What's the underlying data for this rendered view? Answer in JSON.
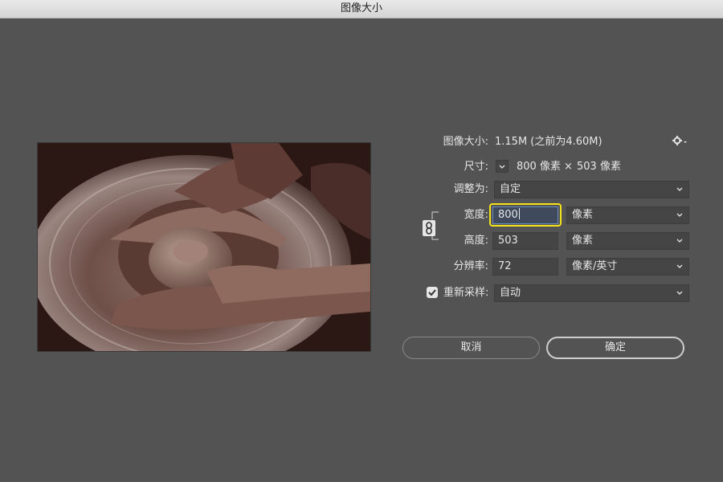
{
  "window": {
    "title": "图像大小"
  },
  "info": {
    "image_size_label": "图像大小:",
    "image_size_value": "1.15M (之前为4.60M)",
    "dimensions_label": "尺寸:",
    "dimensions_width": "800 像素",
    "dimensions_times": "×",
    "dimensions_height": "503 像素"
  },
  "form": {
    "fit_to_label": "调整为:",
    "fit_to_value": "自定",
    "width_label": "宽度:",
    "width_value": "800",
    "width_unit": "像素",
    "height_label": "高度:",
    "height_value": "503",
    "height_unit": "像素",
    "resolution_label": "分辨率:",
    "resolution_value": "72",
    "resolution_unit": "像素/英寸",
    "resample_label": "重新采样:",
    "resample_value": "自动",
    "resample_checked": true
  },
  "buttons": {
    "cancel": "取消",
    "ok": "确定"
  },
  "icons": {
    "gear": "gear-icon",
    "link": "link-icon",
    "check": "checkmark-icon",
    "chevron": "chevron-down-icon"
  },
  "colors": {
    "background": "#535353",
    "highlight": "#f2e31b",
    "field": "#454545"
  }
}
